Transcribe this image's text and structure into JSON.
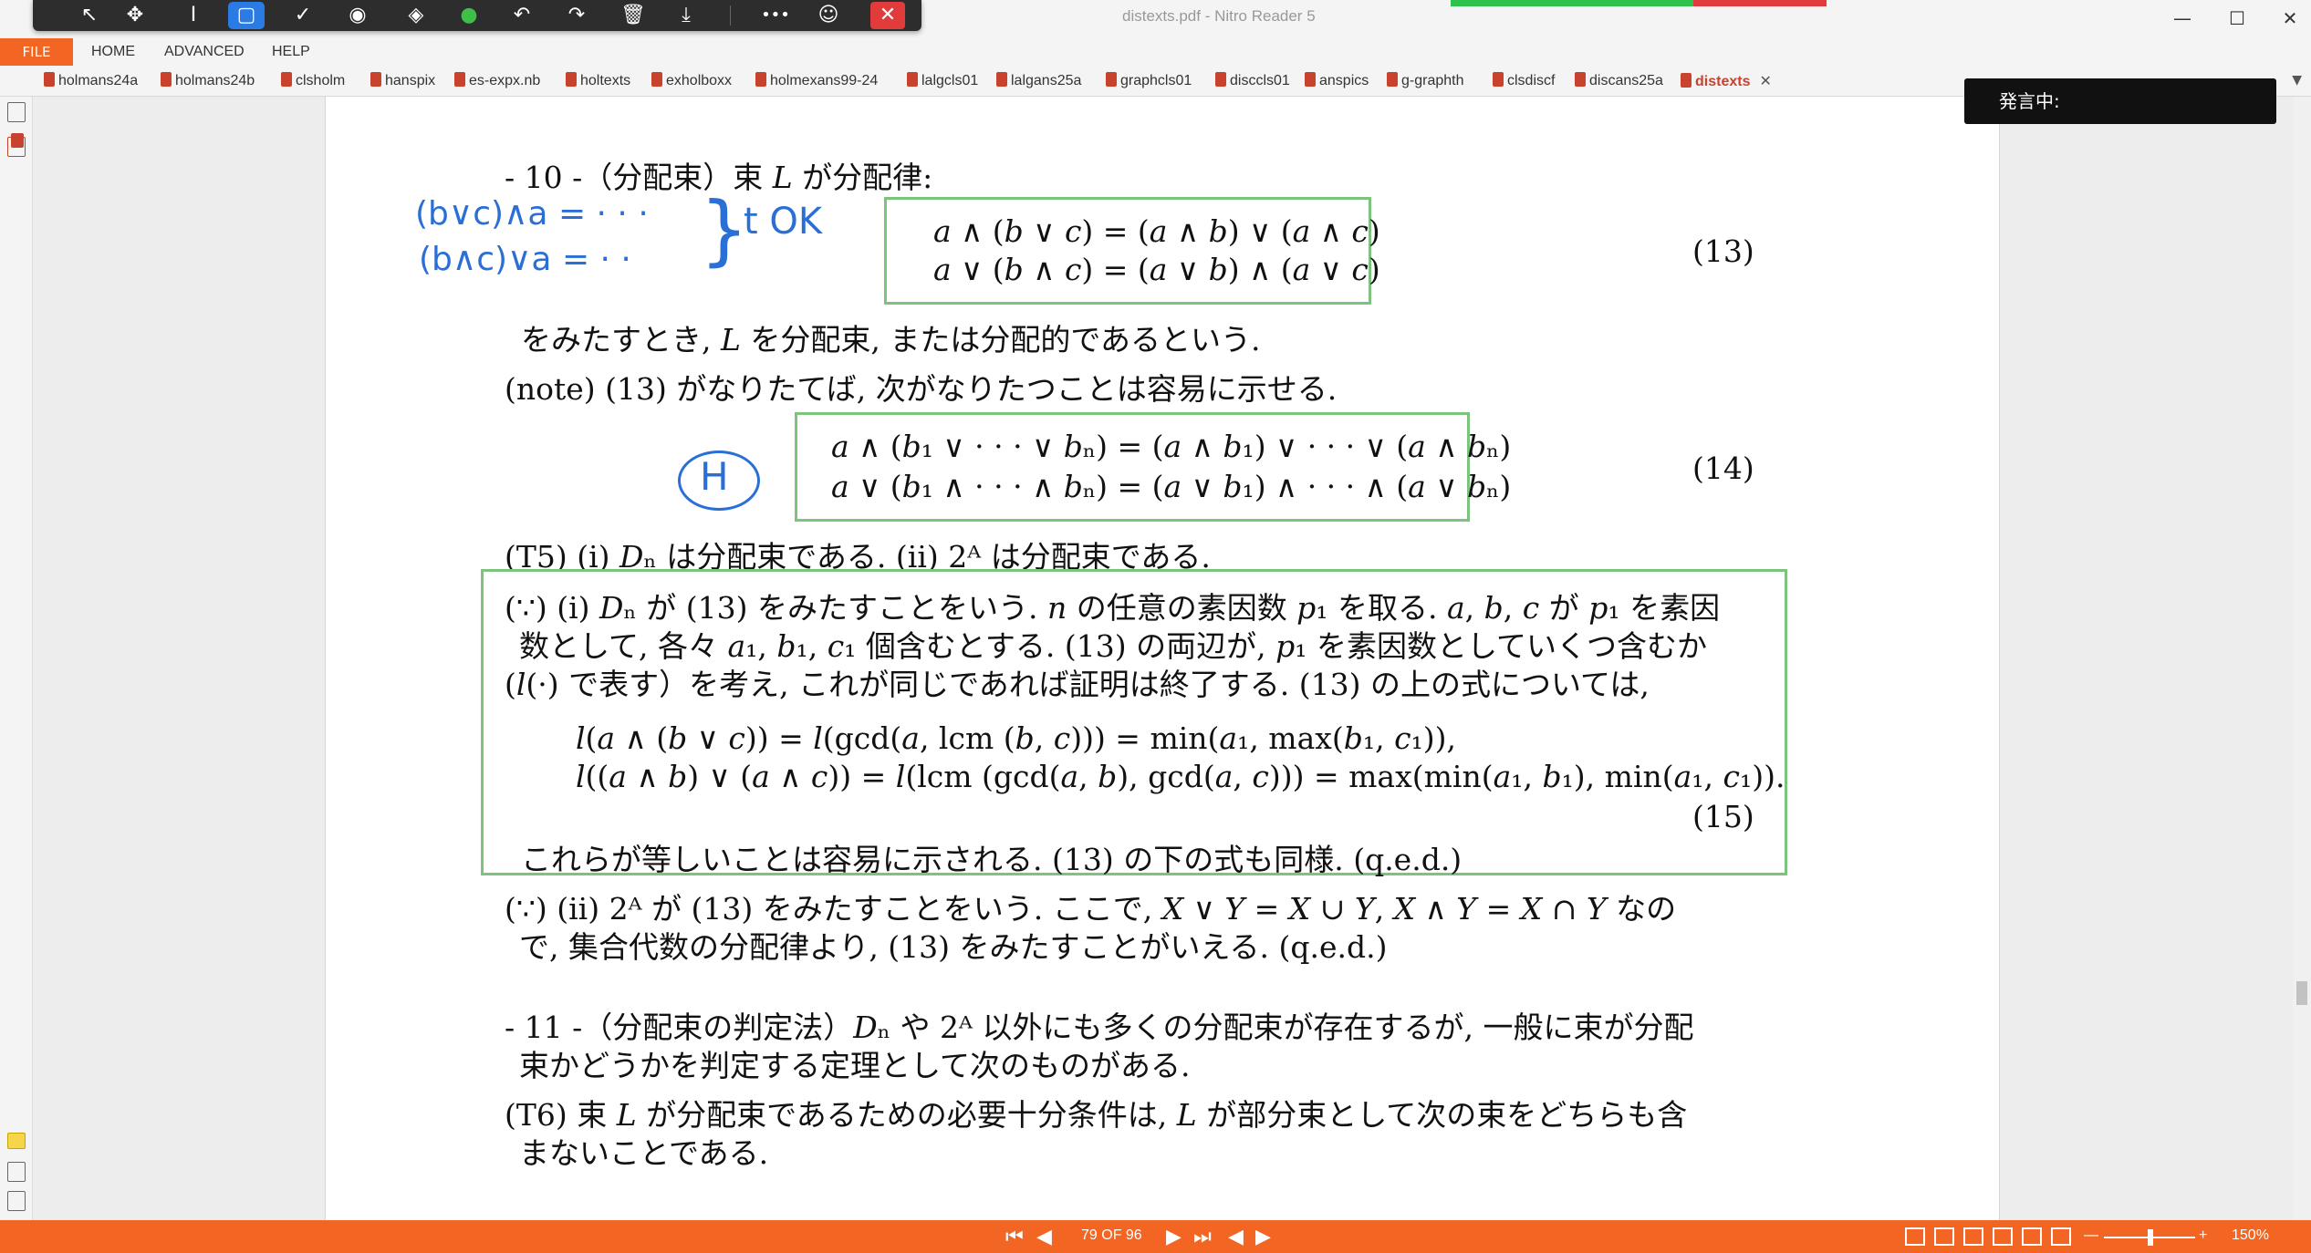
{
  "window": {
    "title": "distexts.pdf - Nitro Reader 5",
    "minimize": "—",
    "maximize": "☐",
    "close": "✕"
  },
  "annotation_toolbar": {
    "tools": [
      "select-arrow-icon",
      "move-icon",
      "text-cursor-icon",
      "rectangle-icon",
      "check-icon",
      "stamp-icon",
      "eraser-icon",
      "color-dot-icon",
      "undo-icon",
      "redo-icon",
      "delete-icon",
      "download-icon",
      "more-icon",
      "user-icon"
    ],
    "more": "•••",
    "close": "✕",
    "accent": "#2b7be4"
  },
  "menu": {
    "file": "FILE",
    "items": [
      "HOME",
      "ADVANCED",
      "HELP"
    ]
  },
  "tabs": [
    "holmans24a",
    "holmans24b",
    "clsholm",
    "hanspix",
    "es-expx.nb",
    "holtexts",
    "exholboxx",
    "holmexans99-24",
    "lalgcls01",
    "lalgans25a",
    "graphcls01",
    "disccls01",
    "anspics",
    "g-graphth",
    "clsdiscf",
    "discans25a"
  ],
  "active_tab": "distexts",
  "tab_close": "✕",
  "speech_indicator": "発言中:",
  "document": {
    "lines": {
      "s10_head": "- 10 -（分配束）束 𝐿 が分配律:",
      "eq13_a": "𝑎 ∧ (𝑏 ∨ 𝑐) = (𝑎 ∧ 𝑏) ∨ (𝑎 ∧ 𝑐)",
      "eq13_b": "𝑎 ∨ (𝑏 ∧ 𝑐) = (𝑎 ∨ 𝑏) ∧ (𝑎 ∨ 𝑐)",
      "num13": "(13)",
      "def_line": "をみたすとき, 𝐿 を分配束, または分配的であるという.",
      "note_line": "(note) (13) がなりたてば, 次がなりたつことは容易に示せる.",
      "eq14_a": "𝑎 ∧ (𝑏₁ ∨ · · · ∨ 𝑏ₙ) = (𝑎 ∧ 𝑏₁) ∨ · · · ∨ (𝑎 ∧ 𝑏ₙ)",
      "eq14_b": "𝑎 ∨ (𝑏₁ ∧ · · · ∧ 𝑏ₙ) = (𝑎 ∨ 𝑏₁) ∧ · · · ∧ (𝑎 ∨ 𝑏ₙ)",
      "num14": "(14)",
      "t5_line": "(T5) (i) 𝐷ₙ は分配束である.  (ii) 2ᴬ は分配束である.",
      "proof1_l1": "(∵) (i) 𝐷ₙ が (13) をみたすことをいう. 𝑛 の任意の素因数 𝑝₁ を取る. 𝑎, 𝑏, 𝑐 が 𝑝₁ を素因",
      "proof1_l2": "数として, 各々 𝑎₁, 𝑏₁, 𝑐₁ 個含むとする. (13) の両辺が, 𝑝₁ を素因数としていくつ含むか",
      "proof1_l3": "(𝑙(·) で表す）を考え, これが同じであれば証明は終了する. (13) の上の式については,",
      "eq15_a": "𝑙(𝑎 ∧ (𝑏 ∨ 𝑐)) = 𝑙(gcd(𝑎, lcm (𝑏, 𝑐))) = min(𝑎₁, max(𝑏₁, 𝑐₁)),",
      "eq15_b": "𝑙((𝑎 ∧ 𝑏) ∨ (𝑎 ∧ 𝑐)) = 𝑙(lcm (gcd(𝑎, 𝑏), gcd(𝑎, 𝑐))) = max(min(𝑎₁, 𝑏₁), min(𝑎₁, 𝑐₁)).",
      "num15": "(15)",
      "proof1_end": "これらが等しいことは容易に示される. (13) の下の式も同様.  (q.e.d.)",
      "proof2_l1": "(∵) (ii) 2ᴬ が (13) をみたすことをいう. ここで, 𝑋 ∨ 𝑌 = 𝑋 ∪ 𝑌, 𝑋 ∧ 𝑌 = 𝑋 ∩ 𝑌 なの",
      "proof2_l2": "で, 集合代数の分配律より, (13) をみたすことがいえる.  (q.e.d.)",
      "s11_l1": "- 11 -（分配束の判定法）𝐷ₙ や 2ᴬ 以外にも多くの分配束が存在するが, 一般に束が分配",
      "s11_l2": "束かどうかを判定する定理として次のものがある.",
      "t6_l1": "(T6) 束 𝐿 が分配束であるための必要十分条件は, 𝐿 が部分束として次の束をどちらも含",
      "t6_l2": "まないことである."
    },
    "handwriting": {
      "line1": "(b∨c)∧a = · · ·",
      "line2": "(b∧c)∨a = · ·",
      "brace": "}",
      "ok": "t OK",
      "circled": "H"
    },
    "box_color": "#7cc37e",
    "ink_color": "#2a6fd6"
  },
  "status": {
    "page_info": "79 OF 96",
    "zoom": "150%",
    "zoom_minus": "—",
    "zoom_plus": "+",
    "accent": "#f26522"
  }
}
